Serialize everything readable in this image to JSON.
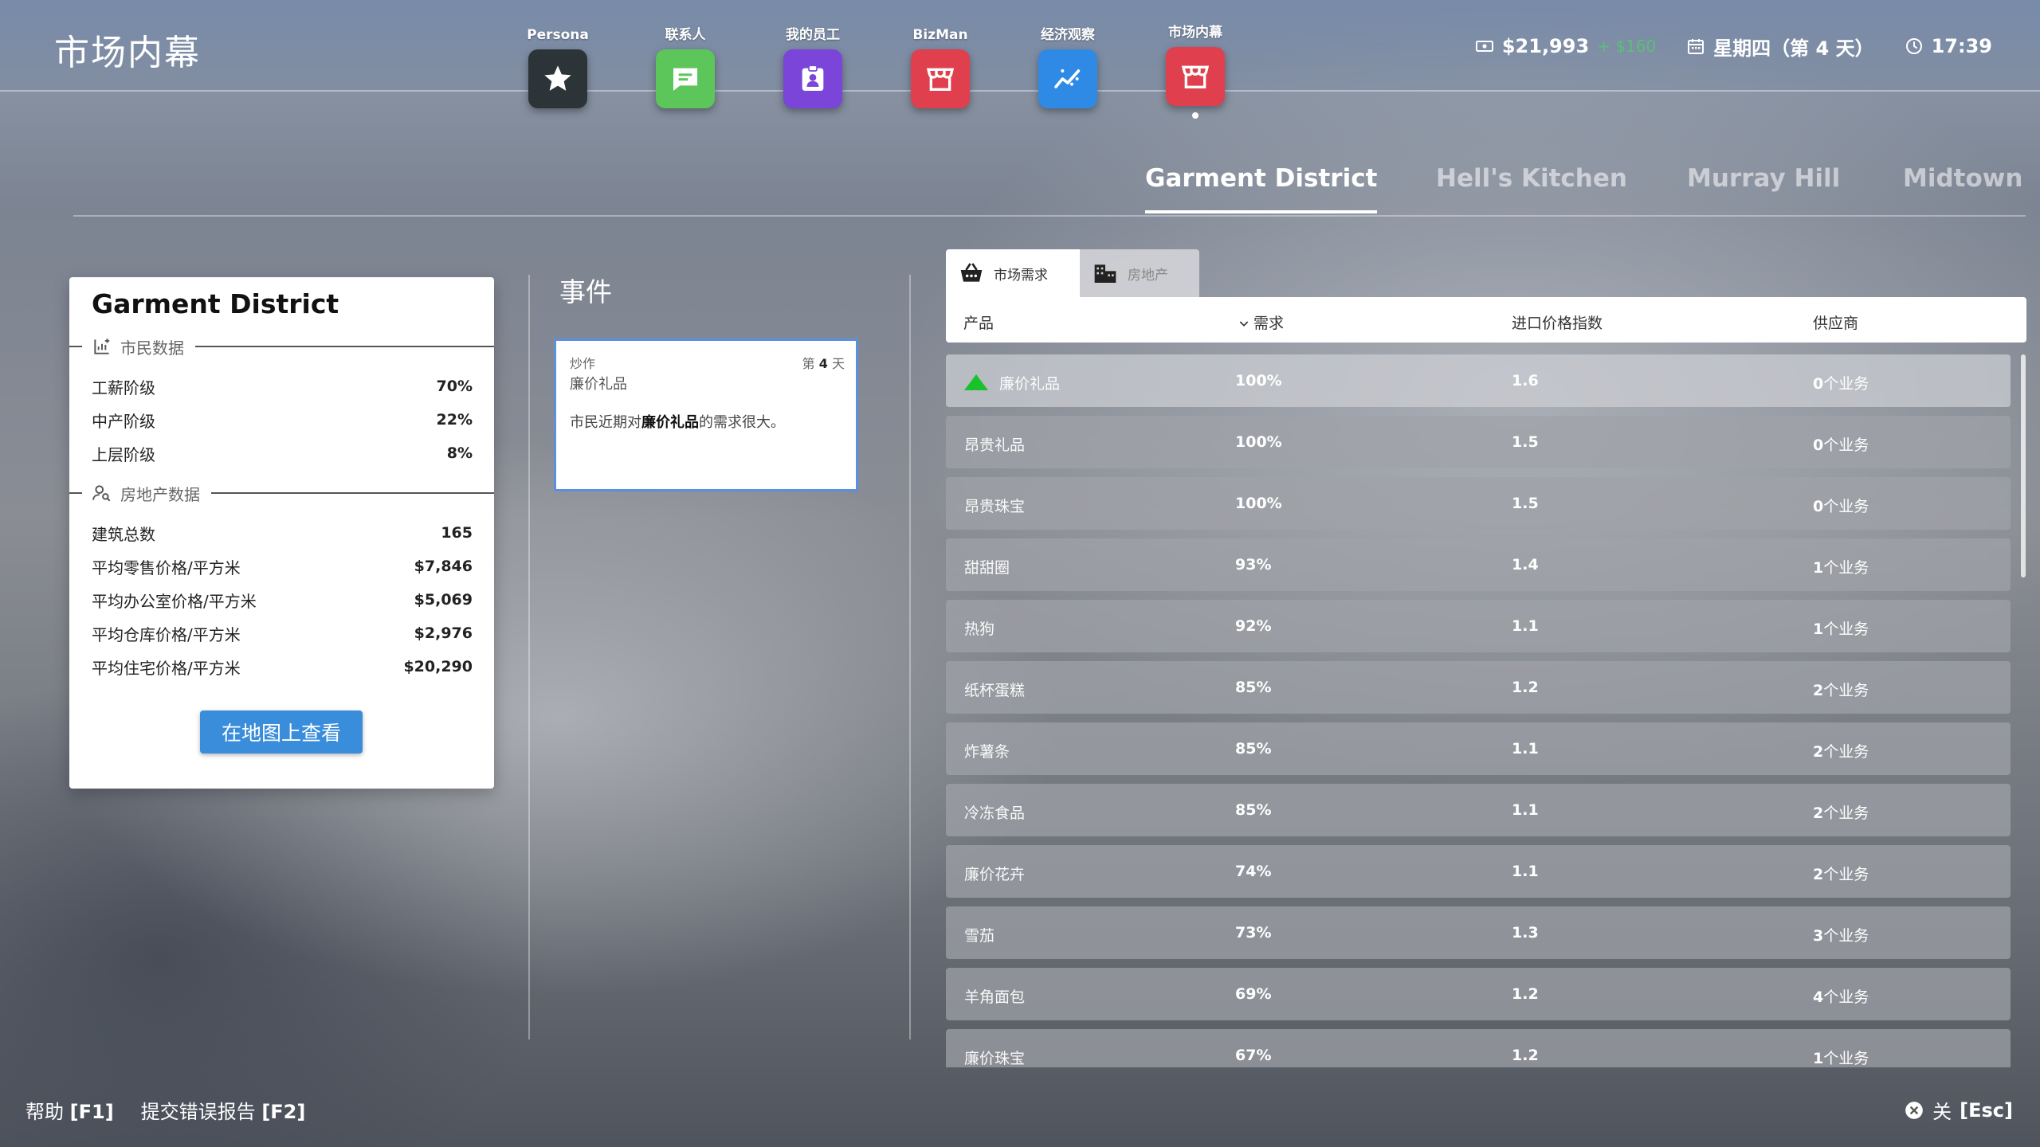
{
  "header": {
    "title": "市场内幕",
    "apps": [
      {
        "label": "Persona",
        "icon": "star-icon",
        "color": "#2d3438"
      },
      {
        "label": "联系人",
        "icon": "chat-icon",
        "color": "#5cc65a"
      },
      {
        "label": "我的员工",
        "icon": "id-badge-icon",
        "color": "#7a45d8"
      },
      {
        "label": "BizMan",
        "icon": "store-icon",
        "color": "#e0404e"
      },
      {
        "label": "经济观察",
        "icon": "trend-chart-icon",
        "color": "#2f8ae6"
      },
      {
        "label": "市场内幕",
        "icon": "store-icon",
        "color": "#e0404e"
      }
    ],
    "status": {
      "money": "$21,993",
      "money_delta": "+ $160",
      "date": "星期四（第 4 天）",
      "time": "17:39"
    }
  },
  "district_tabs": [
    "Garment District",
    "Hell's Kitchen",
    "Murray Hill",
    "Midtown"
  ],
  "district_card": {
    "title": "Garment District",
    "citizen_section": "市民数据",
    "citizens": [
      {
        "label": "工薪阶级",
        "value": "70%"
      },
      {
        "label": "中产阶级",
        "value": "22%"
      },
      {
        "label": "上层阶级",
        "value": "8%"
      }
    ],
    "realestate_section": "房地产数据",
    "realestate": [
      {
        "label": "建筑总数",
        "value": "165"
      },
      {
        "label": "平均零售价格/平方米",
        "value": "$7,846"
      },
      {
        "label": "平均办公室价格/平方米",
        "value": "$5,069"
      },
      {
        "label": "平均仓库价格/平方米",
        "value": "$2,976"
      },
      {
        "label": "平均住宅价格/平方米",
        "value": "$20,290"
      }
    ],
    "map_button": "在地图上查看"
  },
  "events": {
    "title": "事件",
    "card": {
      "category": "炒作",
      "day_prefix": "第 ",
      "day_number": "4",
      "day_suffix": " 天",
      "product": "廉价礼品",
      "desc_before": "市民近期对",
      "desc_product": "廉价礼品",
      "desc_after": "的需求很大。"
    }
  },
  "market": {
    "tabs": [
      "市场需求",
      "房地产"
    ],
    "columns": {
      "product": "产品",
      "demand": "需求",
      "index": "进口价格指数",
      "suppliers": "供应商"
    },
    "rows": [
      {
        "name": "廉价礼品",
        "demand": "100%",
        "index": "1.6",
        "count": "0",
        "unit": "个业务",
        "trend": "up"
      },
      {
        "name": "昂贵礼品",
        "demand": "100%",
        "index": "1.5",
        "count": "0",
        "unit": "个业务"
      },
      {
        "name": "昂贵珠宝",
        "demand": "100%",
        "index": "1.5",
        "count": "0",
        "unit": "个业务"
      },
      {
        "name": "甜甜圈",
        "demand": "93%",
        "index": "1.4",
        "count": "1",
        "unit": "个业务"
      },
      {
        "name": "热狗",
        "demand": "92%",
        "index": "1.1",
        "count": "1",
        "unit": "个业务"
      },
      {
        "name": "纸杯蛋糕",
        "demand": "85%",
        "index": "1.2",
        "count": "2",
        "unit": "个业务"
      },
      {
        "name": "炸薯条",
        "demand": "85%",
        "index": "1.1",
        "count": "2",
        "unit": "个业务"
      },
      {
        "name": "冷冻食品",
        "demand": "85%",
        "index": "1.1",
        "count": "2",
        "unit": "个业务"
      },
      {
        "name": "廉价花卉",
        "demand": "74%",
        "index": "1.1",
        "count": "2",
        "unit": "个业务"
      },
      {
        "name": "雪茄",
        "demand": "73%",
        "index": "1.3",
        "count": "3",
        "unit": "个业务"
      },
      {
        "name": "羊角面包",
        "demand": "69%",
        "index": "1.2",
        "count": "4",
        "unit": "个业务"
      },
      {
        "name": "廉价珠宝",
        "demand": "67%",
        "index": "1.2",
        "count": "1",
        "unit": "个业务"
      }
    ]
  },
  "footer": {
    "help_label": "帮助",
    "help_key": "[F1]",
    "bug_label": "提交错误报告",
    "bug_key": "[F2]",
    "close_label": "关",
    "close_key": "[Esc]"
  }
}
